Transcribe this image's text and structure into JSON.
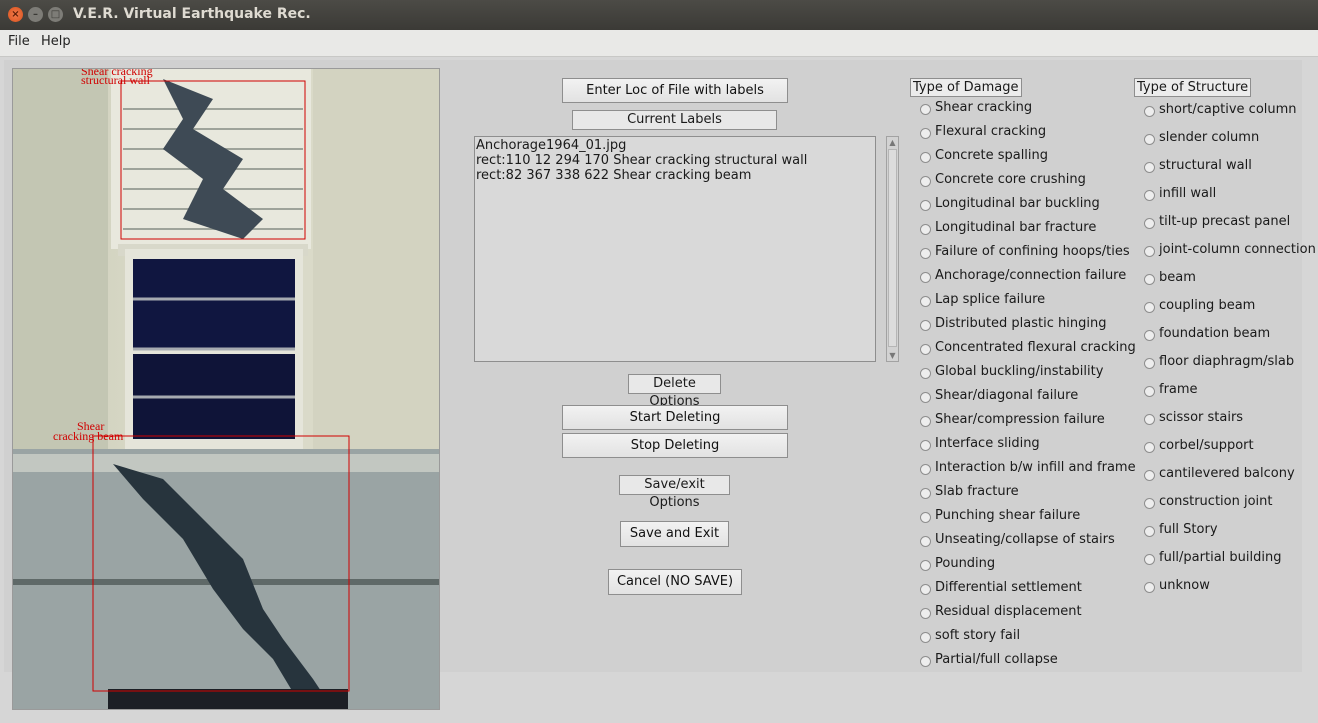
{
  "window": {
    "title": "V.E.R. Virtual Earthquake Rec."
  },
  "menubar": {
    "items": [
      "File",
      "Help"
    ]
  },
  "image": {
    "annotations": [
      {
        "label_line1": "Shear cracking",
        "label_line2": "structural wall"
      },
      {
        "label_line1": "Shear",
        "label_line2": "cracking beam"
      }
    ]
  },
  "center": {
    "enter_loc_label": "Enter Loc of File with labels",
    "current_labels_heading": "Current Labels",
    "lines": [
      "Anchorage1964_01.jpg⁣",
      "rect:110 12 294 170 Shear cracking structural wall",
      "rect:82 367 338 622 Shear cracking beam"
    ],
    "delete_options_heading": "Delete Options",
    "start_deleting_label": "Start Deleting",
    "stop_deleting_label": "Stop Deleting",
    "save_exit_heading": "Save/exit Options",
    "save_and_exit_label": "Save and Exit",
    "cancel_label": "Cancel (NO SAVE)"
  },
  "damage": {
    "heading": "Type of Damage",
    "options": [
      "Shear cracking",
      "Flexural cracking",
      "Concrete spalling",
      "Concrete core crushing",
      "Longitudinal bar buckling",
      "Longitudinal bar fracture",
      "Failure of confining hoops/ties",
      "Anchorage/connection failure",
      "Lap splice failure",
      "Distributed plastic hinging",
      "Concentrated flexural cracking",
      "Global buckling/instability",
      "Shear/diagonal failure",
      "Shear/compression failure",
      "Interface sliding",
      "Interaction b/w infill and frame",
      "Slab fracture",
      "Punching shear failure",
      "Unseating/collapse of stairs",
      "Pounding",
      "Differential settlement",
      "Residual displacement",
      "soft story fail",
      "Partial/full collapse"
    ]
  },
  "structure": {
    "heading": "Type of Structure",
    "options": [
      "short/captive column",
      "slender column",
      "structural wall",
      "infill wall",
      "tilt-up precast panel",
      "joint-column connection",
      "beam",
      "coupling beam",
      "foundation beam",
      "floor diaphragm/slab",
      "frame",
      "scissor stairs",
      "corbel/support",
      "cantilevered balcony",
      "construction joint",
      "full Story",
      "full/partial building",
      "unknow"
    ]
  }
}
